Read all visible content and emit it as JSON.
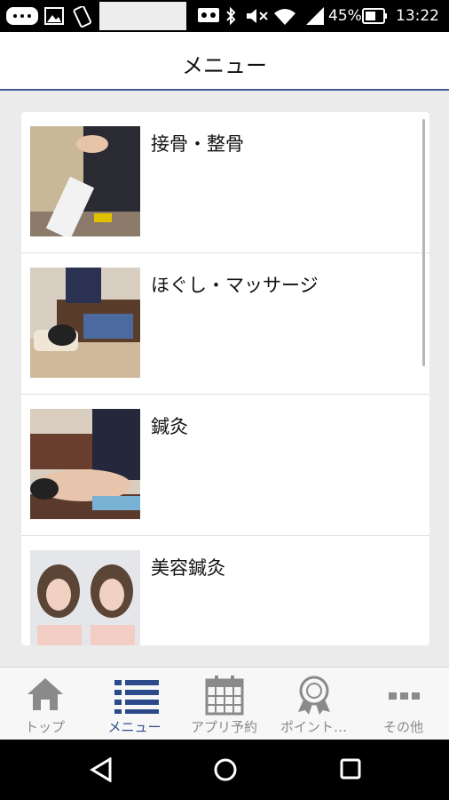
{
  "status_bar": {
    "battery": "45%",
    "time": "13:22"
  },
  "header": {
    "title": "メニュー"
  },
  "menu": {
    "items": [
      {
        "label": "接骨・整骨"
      },
      {
        "label": "ほぐし・マッサージ"
      },
      {
        "label": "鍼灸"
      },
      {
        "label": "美容鍼灸"
      }
    ]
  },
  "bottom_nav": {
    "tabs": [
      {
        "label": "トップ",
        "icon": "home-icon"
      },
      {
        "label": "メニュー",
        "icon": "list-icon",
        "active": true
      },
      {
        "label": "アプリ予約",
        "icon": "calendar-icon"
      },
      {
        "label": "ポイント…",
        "icon": "award-icon"
      },
      {
        "label": "その他",
        "icon": "more-icon"
      }
    ],
    "active_color": "#2c4a8a",
    "inactive_color": "#8a8a8a"
  }
}
